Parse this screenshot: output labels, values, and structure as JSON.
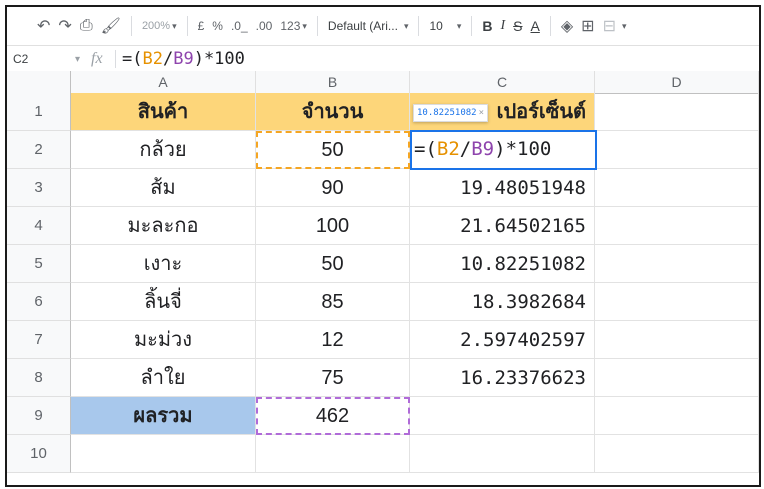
{
  "toolbar": {
    "undo_icon": "undo-icon",
    "redo_icon": "redo-icon",
    "print_icon": "print-icon",
    "paint_icon": "paint-format-icon",
    "zoom": "200%",
    "currency": "£",
    "percent": "%",
    "dec_decrease": ".0_",
    "dec_increase": ".00",
    "more_formats": "123",
    "font": "Default (Ari...",
    "font_size": "10",
    "bold": "B",
    "italic": "I",
    "strike": "S",
    "text_color": "A"
  },
  "formula_bar": {
    "cell_ref": "C2",
    "fx": "fx",
    "formula_prefix": "=(",
    "ref1": "B2",
    "slash": "/",
    "ref2": "B9",
    "suffix": ")*100"
  },
  "columns": [
    "A",
    "B",
    "C",
    "D"
  ],
  "rows": [
    {
      "num": "1",
      "a": "สินค้า",
      "b": "จำนวน",
      "c": "เปอร์เซ็นต์"
    },
    {
      "num": "2",
      "a": "กล้วย",
      "b": "50",
      "c": ""
    },
    {
      "num": "3",
      "a": "ส้ม",
      "b": "90",
      "c": "19.48051948"
    },
    {
      "num": "4",
      "a": "มะละกอ",
      "b": "100",
      "c": "21.64502165"
    },
    {
      "num": "5",
      "a": "เงาะ",
      "b": "50",
      "c": "10.82251082"
    },
    {
      "num": "6",
      "a": "ลิ้นจี่",
      "b": "85",
      "c": "18.3982684"
    },
    {
      "num": "7",
      "a": "มะม่วง",
      "b": "12",
      "c": "2.597402597"
    },
    {
      "num": "8",
      "a": "ลำใย",
      "b": "75",
      "c": "16.23376623"
    },
    {
      "num": "9",
      "a": "ผลรวม",
      "b": "462",
      "c": ""
    },
    {
      "num": "10",
      "a": "",
      "b": "",
      "c": ""
    }
  ],
  "active_cell": {
    "prefix": "=(",
    "ref1": "B2",
    "slash": "/",
    "ref2": "B9",
    "suffix": ")*100"
  },
  "tooltip": {
    "value": "10.82251082",
    "close": "×"
  },
  "colors": {
    "header_yellow": "#fdd67a",
    "total_blue": "#a8c8ec",
    "ref_orange": "#e69100",
    "ref_purple": "#8e44ad",
    "selection_blue": "#1a73e8"
  }
}
